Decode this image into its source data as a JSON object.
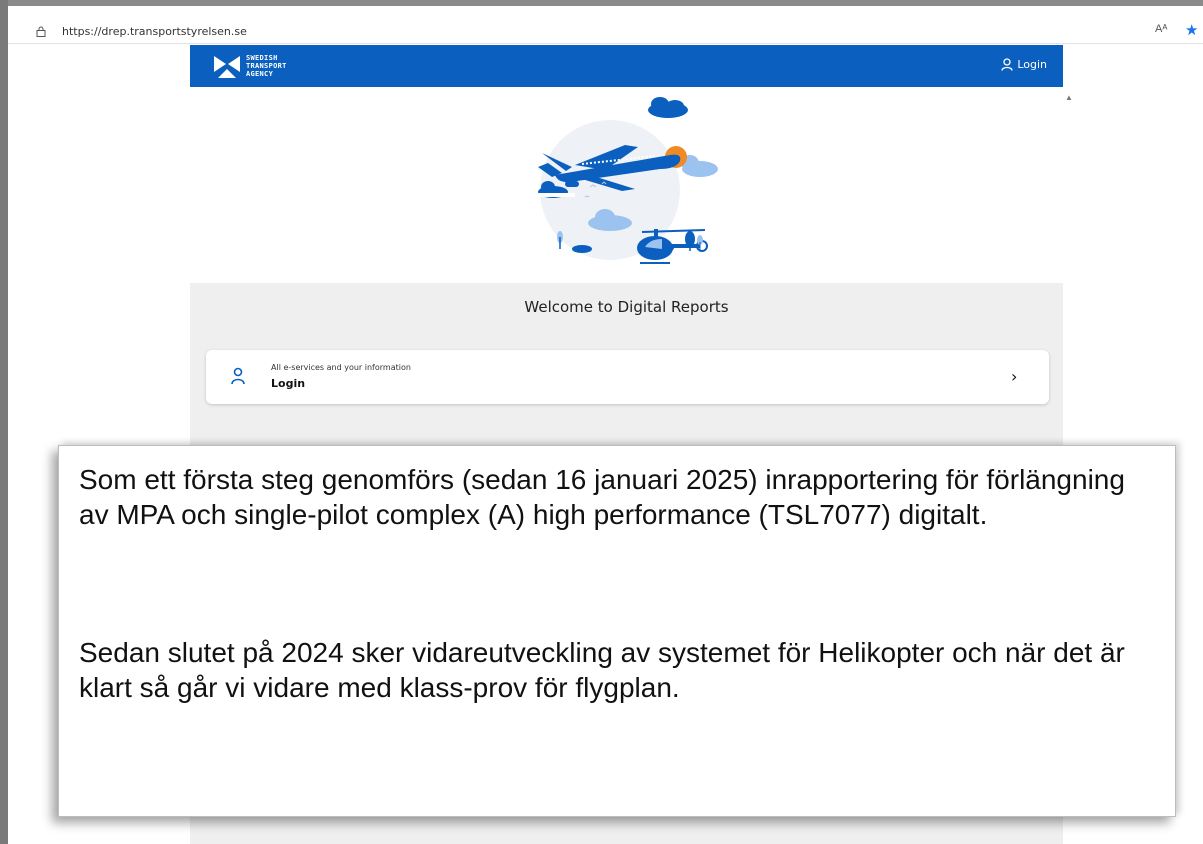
{
  "browser": {
    "url": "https://drep.transportstyrelsen.se",
    "read_aloud_glyph": "Aᴬ",
    "favorite_glyph": "★"
  },
  "site": {
    "logo": {
      "line1": "SWEDISH",
      "line2": "TRANSPORT",
      "line3": "AGENCY"
    },
    "header_login_label": "Login",
    "welcome_title": "Welcome to Digital Reports",
    "login_card": {
      "subtitle": "All e-services and your information",
      "title": "Login",
      "chevron": "›"
    },
    "colors": {
      "header_blue": "#0b5fbf",
      "accent_orange": "#f08a24",
      "page_gray": "#efefef"
    }
  },
  "note": {
    "paragraph1": "Som ett första steg genomförs (sedan 16 januari 2025) inrapportering för förlängning av MPA och single-pilot complex (A) high performance (TSL7077) digitalt.",
    "paragraph2": "Sedan slutet på 2024 sker vidareutveckling av systemet för Helikopter och när det är klart så går vi vidare med klass-prov för flygplan."
  }
}
